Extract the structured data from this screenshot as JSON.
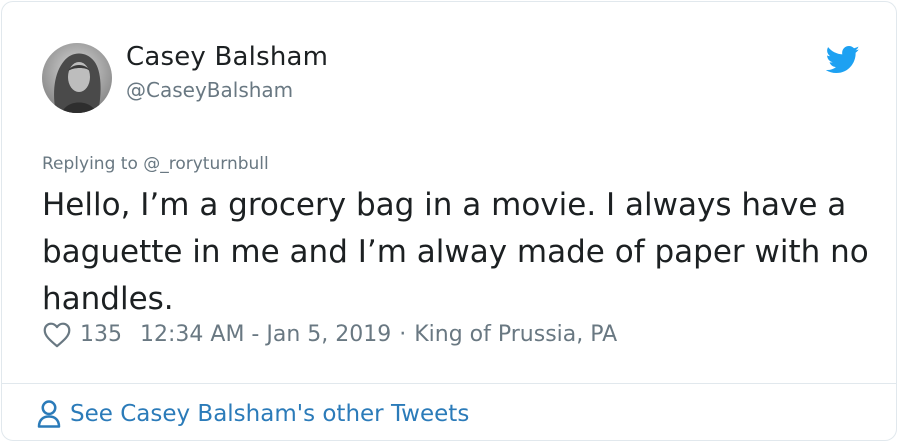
{
  "user": {
    "display_name": "Casey Balsham",
    "handle": "@CaseyBalsham",
    "avatar_icon": "profile-photo"
  },
  "brand": {
    "icon": "twitter-bird-icon",
    "color": "#1da1f2"
  },
  "tweet": {
    "replying_to": "Replying to @_roryturnbull",
    "text": "Hello, I’m a grocery bag in a movie. I always have a baguette in me and I’m alway made of paper with no handles.",
    "like_count": "135",
    "time": "12:34 AM - Jan 5, 2019",
    "separator": "·",
    "location": "King of Prussia, PA"
  },
  "footer": {
    "link_label": "See Casey Balsham's other Tweets",
    "link_color": "#2b7bb9"
  }
}
